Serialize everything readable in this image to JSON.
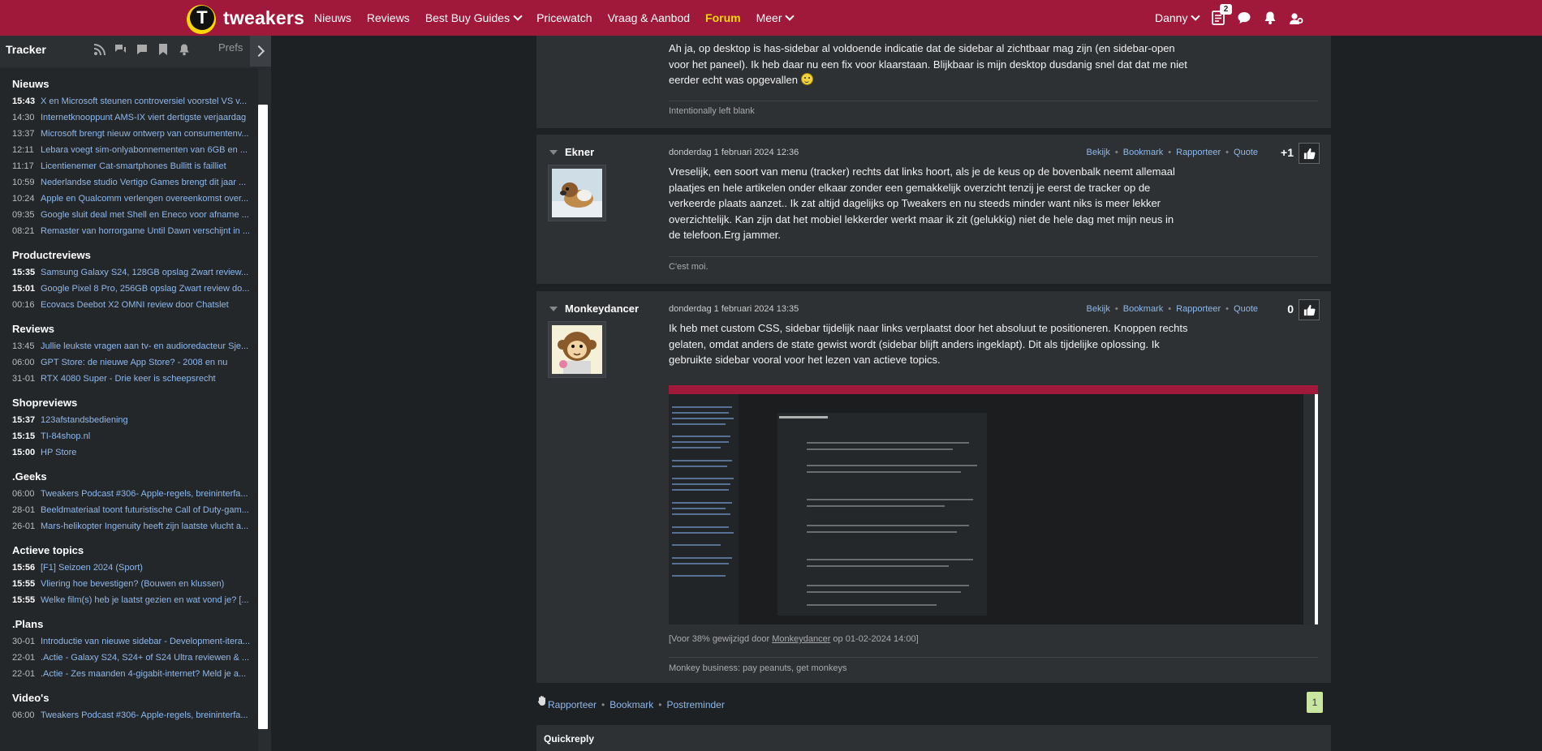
{
  "header": {
    "logo_text": "tweakers",
    "nav": [
      {
        "label": "Nieuws"
      },
      {
        "label": "Reviews"
      },
      {
        "label": "Best Buy Guides"
      },
      {
        "label": "Pricewatch"
      },
      {
        "label": "Vraag & Aanbod"
      },
      {
        "label": "Forum"
      },
      {
        "label": "Meer"
      }
    ],
    "active_nav": "Forum",
    "user": "Danny",
    "notification_count": "2",
    "brand_color": "#a0183a",
    "accent_color": "#fcd700"
  },
  "tracker": {
    "title": "Tracker",
    "prefs_label": "Prefs",
    "sections": [
      {
        "name": "Nieuws",
        "items": [
          {
            "time": "15:43",
            "title": "X en Microsoft steunen controversiel voorstel VS v...",
            "unread": true
          },
          {
            "time": "14:30",
            "title": "Internetknooppunt AMS-IX viert dertigste verjaardag",
            "unread": false
          },
          {
            "time": "13:37",
            "title": "Microsoft brengt nieuw ontwerp van consumentenv...",
            "unread": false
          },
          {
            "time": "12:11",
            "title": "Lebara voegt sim-onlyabonnementen van 6GB en ...",
            "unread": false
          },
          {
            "time": "11:17",
            "title": "Licentienemer Cat-smartphones Bullitt is failliet",
            "unread": false
          },
          {
            "time": "10:59",
            "title": "Nederlandse studio Vertigo Games brengt dit jaar ...",
            "unread": false
          },
          {
            "time": "10:24",
            "title": "Apple en Qualcomm verlengen overeenkomst over...",
            "unread": false
          },
          {
            "time": "09:35",
            "title": "Google sluit deal met Shell en Eneco voor afname ...",
            "unread": false
          },
          {
            "time": "08:21",
            "title": "Remaster van horrorgame Until Dawn verschijnt in ...",
            "unread": false
          }
        ]
      },
      {
        "name": "Productreviews",
        "items": [
          {
            "time": "15:35",
            "title": "Samsung Galaxy S24, 128GB opslag Zwart review...",
            "unread": true
          },
          {
            "time": "15:01",
            "title": "Google Pixel 8 Pro, 256GB opslag Zwart review do...",
            "unread": true
          },
          {
            "time": "00:16",
            "title": "Ecovacs Deebot X2 OMNI review door Chatslet",
            "unread": false
          }
        ]
      },
      {
        "name": "Reviews",
        "items": [
          {
            "time": "13:45",
            "title": "Jullie leukste vragen aan tv- en audioredacteur Sje...",
            "unread": false
          },
          {
            "time": "06:00",
            "title": "GPT Store: de nieuwe App Store? - 2008 en nu",
            "unread": false
          },
          {
            "time": "31-01",
            "title": "RTX 4080 Super - Drie keer is scheepsrecht",
            "unread": false
          }
        ]
      },
      {
        "name": "Shopreviews",
        "items": [
          {
            "time": "15:37",
            "title": "123afstandsbediening",
            "unread": true
          },
          {
            "time": "15:15",
            "title": "TI-84shop.nl",
            "unread": true
          },
          {
            "time": "15:00",
            "title": "HP Store",
            "unread": true
          }
        ]
      },
      {
        "name": ".Geeks",
        "items": [
          {
            "time": "06:00",
            "title": "Tweakers Podcast #306- Apple-regels, breininterfa...",
            "unread": false
          },
          {
            "time": "28-01",
            "title": "Beeldmateriaal toont futuristische Call of Duty-gam...",
            "unread": false
          },
          {
            "time": "26-01",
            "title": "Mars-helikopter Ingenuity heeft zijn laatste vlucht a...",
            "unread": false
          }
        ]
      },
      {
        "name": "Actieve topics",
        "items": [
          {
            "time": "15:56",
            "title": "[F1] Seizoen 2024 (Sport)",
            "unread": true
          },
          {
            "time": "15:55",
            "title": "Vliering hoe bevestigen? (Bouwen en klussen)",
            "unread": true
          },
          {
            "time": "15:55",
            "title": "Welke film(s) heb je laatst gezien en wat vond je? [...",
            "unread": true
          }
        ]
      },
      {
        "name": ".Plans",
        "items": [
          {
            "time": "30-01",
            "title": "Introductie van nieuwe sidebar - Development-itera...",
            "unread": false
          },
          {
            "time": "22-01",
            "title": ".Actie - Galaxy S24, S24+ of S24 Ultra reviewen & ...",
            "unread": false
          },
          {
            "time": "22-01",
            "title": ".Actie - Zes maanden 4-gigabit-internet? Meld je a...",
            "unread": false
          }
        ]
      },
      {
        "name": "Video's",
        "items": [
          {
            "time": "06:00",
            "title": "Tweakers Podcast #306- Apple-regels, breininterfa...",
            "unread": false
          }
        ]
      }
    ]
  },
  "posts": [
    {
      "text_lines": [
        "Ah ja, op desktop is has-sidebar al voldoende indicatie dat de sidebar al zichtbaar mag zijn (en sidebar-open",
        "voor het paneel). Ik heb daar nu een fix voor klaarstaan. Blijkbaar is mijn desktop dusdanig snel dat dat me niet",
        "eerder echt was opgevallen"
      ],
      "signature": "Intentionally left blank"
    },
    {
      "author": "Ekner",
      "date": "donderdag 1 februari 2024 12:36",
      "score": "+1",
      "actions": [
        "Bekijk",
        "Bookmark",
        "Rapporteer",
        "Quote"
      ],
      "text_lines": [
        "Vreselijk, een soort van menu (tracker) rechts dat links hoort, als je de keus op de bovenbalk neemt allemaal",
        "plaatjes en hele artikelen onder elkaar zonder een gemakkelijk overzicht tenzij je eerst de tracker op de",
        "verkeerde plaats aanzet.. Ik zat altijd dagelijks op Tweakers en nu steeds minder want niks is meer lekker",
        "overzichtelijk. Kan zijn dat het mobiel lekkerder werkt maar ik zit (gelukkig) niet de hele dag met mijn neus in",
        "de telefoon.Erg jammer."
      ],
      "signature": "C'est moi."
    },
    {
      "author": "Monkeydancer",
      "date": "donderdag 1 februari 2024 13:35",
      "score": "0",
      "actions": [
        "Bekijk",
        "Bookmark",
        "Rapporteer",
        "Quote"
      ],
      "text_lines": [
        "Ik heb met custom CSS, sidebar tijdelijk naar links verplaatst door het absoluut te positioneren. Knoppen rechts",
        "gelaten, omdat anders de state gewist wordt (sidebar blijft anders ingeklapt). Dit als tijdelijke oplossing. Ik",
        "gebruikte sidebar vooral voor het lezen van actieve topics."
      ],
      "edit_prefix": "[Voor 38% gewijzigd door",
      "edit_author": "Monkeydancer",
      "edit_suffix": "op 01-02-2024 14:00]",
      "signature": "Monkey business: pay peanuts, get monkeys"
    }
  ],
  "footer": {
    "links": [
      "Rapporteer",
      "Bookmark",
      "Postreminder"
    ],
    "page": "1",
    "quickreply_label": "Quickreply"
  }
}
